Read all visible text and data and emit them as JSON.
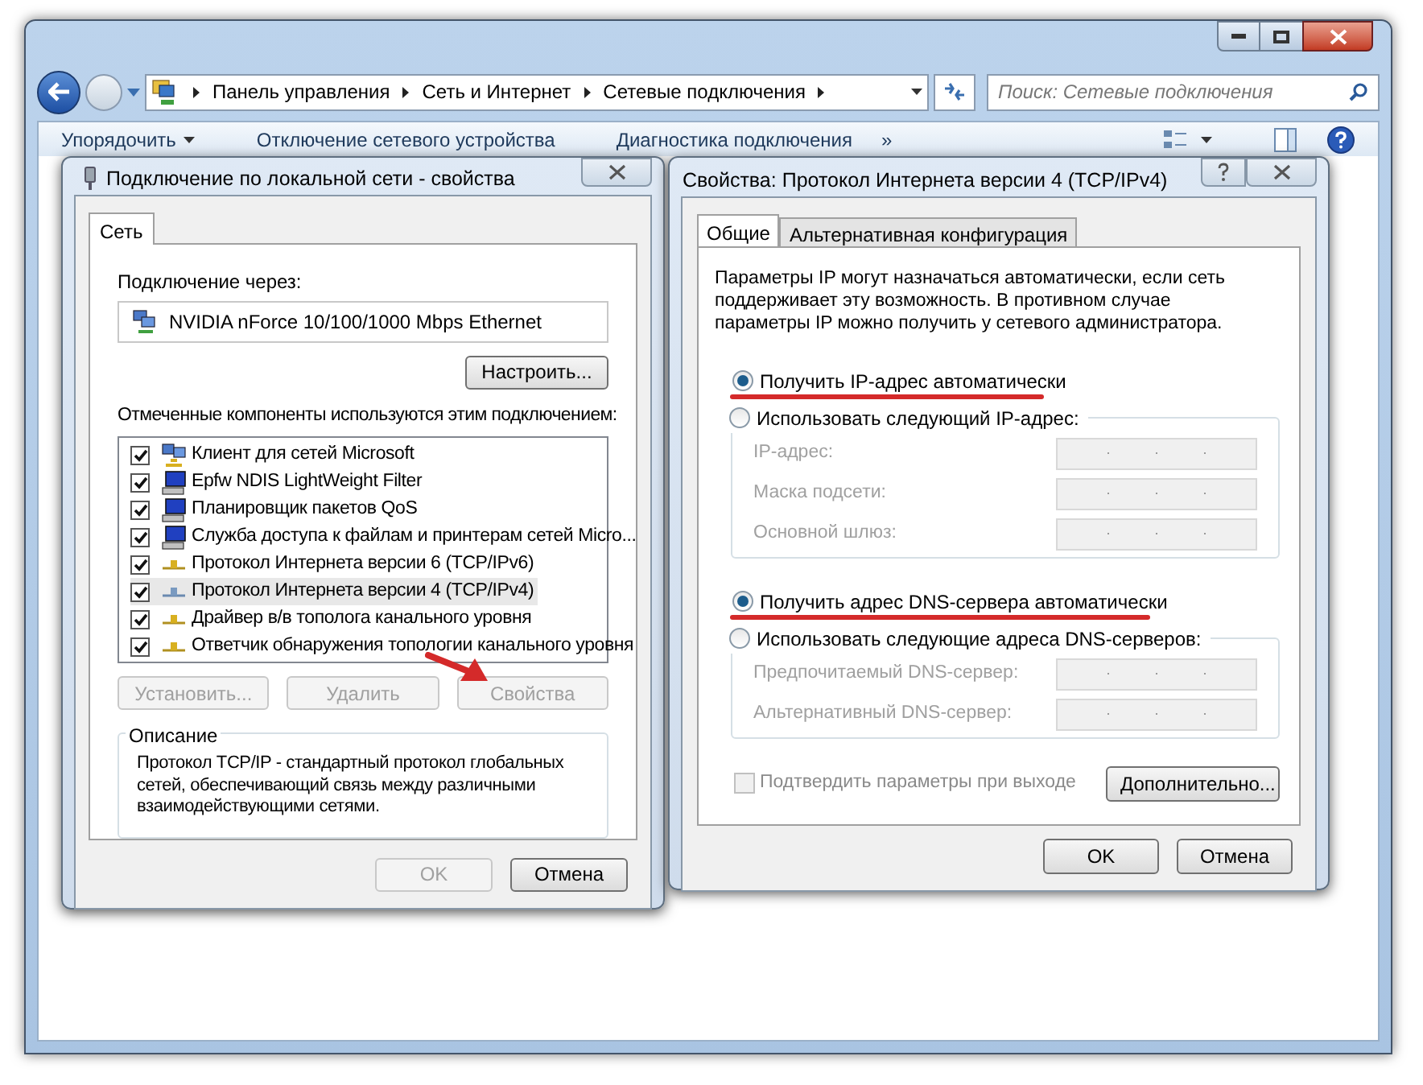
{
  "explorer": {
    "breadcrumbs": [
      "Панель управления",
      "Сеть и Интернет",
      "Сетевые подключения"
    ],
    "search": {
      "placeholder": "Поиск: Сетевые подключения"
    },
    "toolbar": [
      "Упорядочить",
      "Отключение сетевого устройства",
      "Диагностика подключения"
    ],
    "toolbar_more": "»"
  },
  "lan_dialog": {
    "title": "Подключение по локальной сети - свойства",
    "tabs": [
      {
        "label": "Сеть",
        "selected": true
      }
    ],
    "connect_via_label": "Подключение через:",
    "adapter": "NVIDIA nForce 10/100/1000 Mbps Ethernet",
    "configure_button": "Настроить...",
    "components_label": "Отмеченные компоненты используются этим подключением:",
    "components": [
      {
        "kind": "client",
        "label": "Клиент для сетей Microsoft",
        "checked": true,
        "selected": false
      },
      {
        "kind": "service",
        "label": "Epfw NDIS LightWeight Filter",
        "checked": true,
        "selected": false
      },
      {
        "kind": "service",
        "label": "Планировщик пакетов QoS",
        "checked": true,
        "selected": false
      },
      {
        "kind": "service",
        "label": "Служба доступа к файлам и принтерам сетей Micro...",
        "checked": true,
        "selected": false
      },
      {
        "kind": "protocol",
        "label": "Протокол Интернета версии 6 (TCP/IPv6)",
        "checked": true,
        "selected": false
      },
      {
        "kind": "protocol",
        "label": "Протокол Интернета версии 4 (TCP/IPv4)",
        "checked": true,
        "selected": true
      },
      {
        "kind": "protocol",
        "label": "Драйвер в/в тополога канального уровня",
        "checked": true,
        "selected": false
      },
      {
        "kind": "protocol",
        "label": "Ответчик обнаружения топологии канального уровня",
        "checked": true,
        "selected": false
      }
    ],
    "component_buttons": [
      {
        "label": "Установить...",
        "disabled": true
      },
      {
        "label": "Удалить",
        "disabled": true
      },
      {
        "label": "Свойства",
        "disabled": true
      }
    ],
    "description": {
      "title": "Описание",
      "text": "Протокол TCP/IP - стандартный протокол глобальных сетей, обеспечивающий связь между различными взаимодействующими сетями."
    },
    "footer_buttons": [
      {
        "label": "OK",
        "disabled": true
      },
      {
        "label": "Отмена",
        "disabled": false
      }
    ]
  },
  "ipv4_dialog": {
    "title": "Свойства: Протокол Интернета версии 4 (TCP/IPv4)",
    "tabs": [
      {
        "label": "Общие",
        "selected": true
      },
      {
        "label": "Альтернативная конфигурация",
        "selected": false
      }
    ],
    "intro": "Параметры IP могут назначаться автоматически, если сеть поддерживает эту возможность. В противном случае параметры IP можно получить у сетевого администратора.",
    "ip_options": [
      {
        "label": "Получить IP-адрес автоматически",
        "selected": true
      },
      {
        "label": "Использовать следующий IP-адрес:",
        "selected": false
      }
    ],
    "ip_fields": [
      {
        "label": "IP-адрес:",
        "disabled": true
      },
      {
        "label": "Маска подсети:",
        "disabled": true
      },
      {
        "label": "Основной шлюз:",
        "disabled": true
      }
    ],
    "dns_options": [
      {
        "label": "Получить адрес DNS-сервера автоматически",
        "selected": true
      },
      {
        "label": "Использовать следующие адреса DNS-серверов:",
        "selected": false
      }
    ],
    "dns_fields": [
      {
        "label": "Предпочитаемый DNS-сервер:",
        "disabled": true
      },
      {
        "label": "Альтернативный DNS-сервер:",
        "disabled": true
      }
    ],
    "validate": {
      "label": "Подтвердить параметры при выходе",
      "checked": false,
      "disabled": true
    },
    "advanced_button": "Дополнительно...",
    "footer_buttons": [
      {
        "label": "OK",
        "disabled": false
      },
      {
        "label": "Отмена",
        "disabled": false
      }
    ]
  }
}
